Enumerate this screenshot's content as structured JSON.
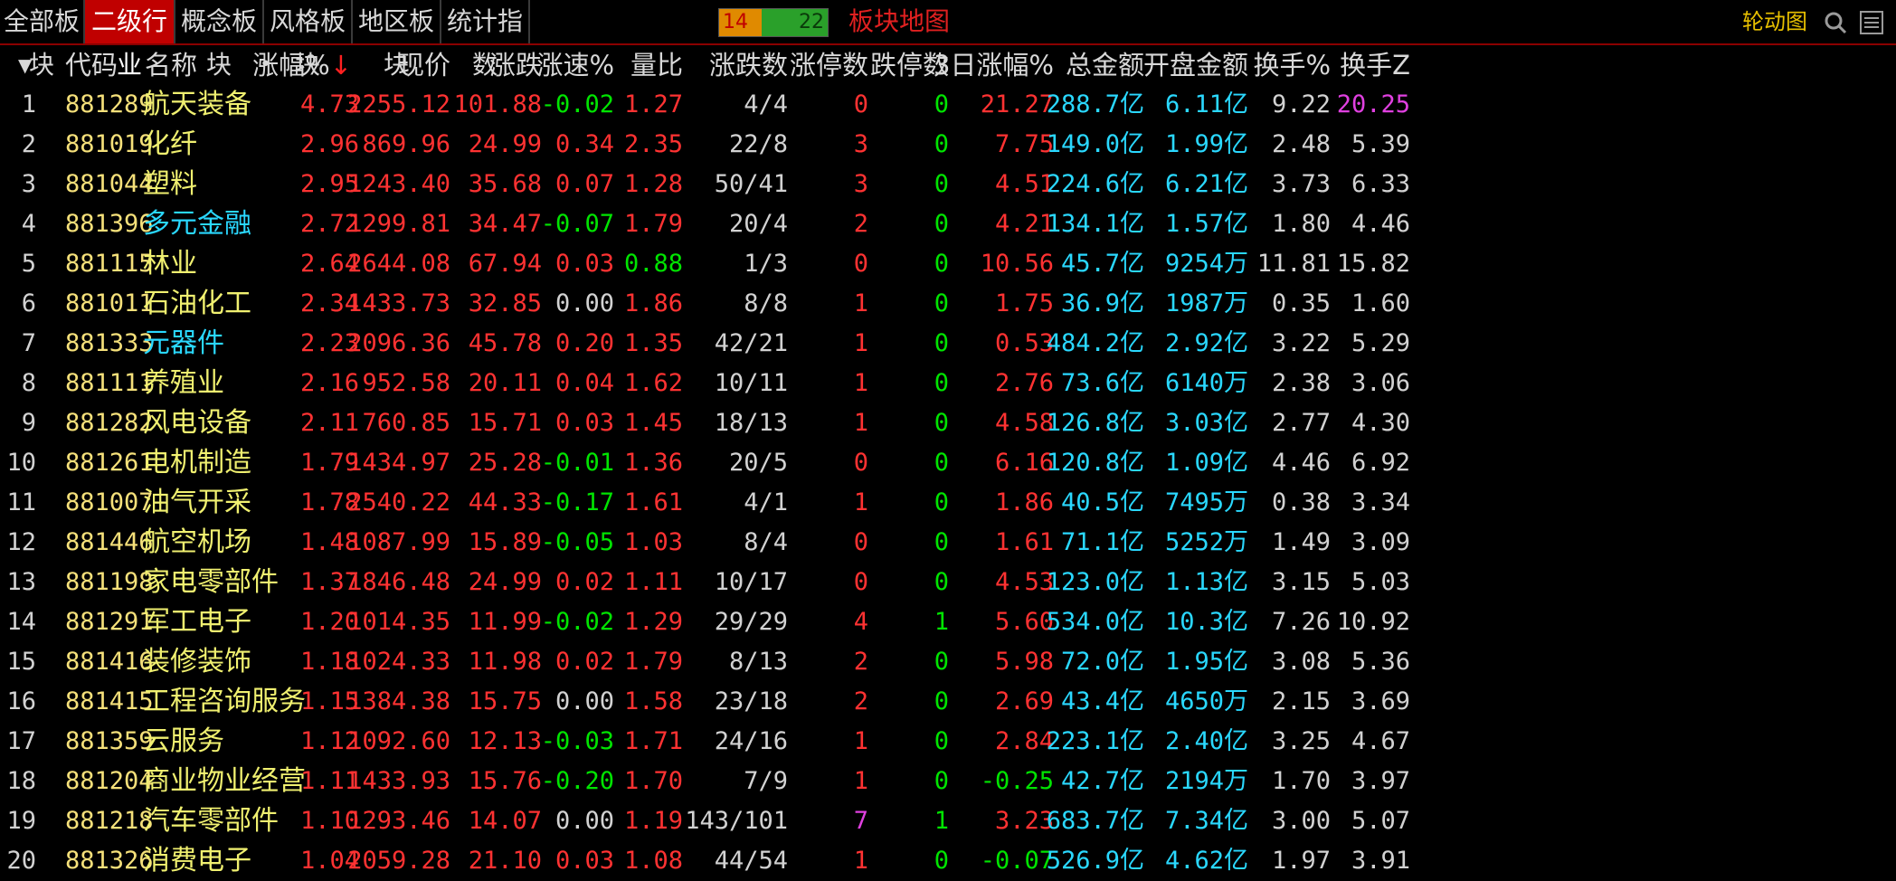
{
  "tabs": [
    "全部板块",
    "二级行业",
    "概念板块",
    "风格板块",
    "地区板块",
    "统计指数"
  ],
  "active_tab": "二级行业",
  "updown_ratio": {
    "up": "14",
    "down": "22"
  },
  "map_label": "板块地图",
  "rotation_label": "轮动图",
  "header": {
    "sort_arrow": "▼",
    "code": "代码",
    "name": "名称",
    "dot": "•",
    "change_pct": "涨幅%",
    "sort_mark": "↓",
    "price": "现价",
    "change": "涨跌",
    "speed": "涨速%",
    "vol_ratio": "量比",
    "up_down": "涨跌数",
    "limit_up": "涨停数",
    "limit_down": "跌停数",
    "chg3d": "3日涨幅%",
    "amount": "总金额",
    "open_amount": "开盘金额",
    "turnover": "换手%",
    "turnover_z": "换手Z"
  },
  "rows": [
    {
      "idx": "1",
      "code": "881289",
      "name": "航天装备",
      "name_color": "yel",
      "pct": "4.73",
      "price": "2255.12",
      "chg": "101.88",
      "speed": "-0.02",
      "vr": "1.27",
      "ud": "4/4",
      "lu": "0",
      "ld": "0",
      "c3": "21.27",
      "amt": "288.7亿",
      "oamt": "6.11亿",
      "to": "9.22",
      "toz": "20.25",
      "toz_color": "mag"
    },
    {
      "idx": "2",
      "code": "881019",
      "name": "化纤",
      "name_color": "yel",
      "pct": "2.96",
      "price": "869.96",
      "chg": "24.99",
      "speed": "0.34",
      "vr": "2.35",
      "ud": "22/8",
      "lu": "3",
      "ld": "0",
      "c3": "7.75",
      "amt": "149.0亿",
      "oamt": "1.99亿",
      "to": "2.48",
      "toz": "5.39",
      "toz_color": "wht"
    },
    {
      "idx": "3",
      "code": "881044",
      "name": "塑料",
      "name_color": "yel",
      "pct": "2.95",
      "price": "1243.40",
      "chg": "35.68",
      "speed": "0.07",
      "vr": "1.28",
      "ud": "50/41",
      "lu": "3",
      "ld": "0",
      "c3": "4.51",
      "amt": "224.6亿",
      "oamt": "6.21亿",
      "to": "3.73",
      "toz": "6.33",
      "toz_color": "wht"
    },
    {
      "idx": "4",
      "code": "881396",
      "name": "多元金融",
      "name_color": "cyan",
      "pct": "2.72",
      "price": "1299.81",
      "chg": "34.47",
      "speed": "-0.07",
      "vr": "1.79",
      "ud": "20/4",
      "lu": "2",
      "ld": "0",
      "c3": "4.21",
      "amt": "134.1亿",
      "oamt": "1.57亿",
      "to": "1.80",
      "toz": "4.46",
      "toz_color": "wht"
    },
    {
      "idx": "5",
      "code": "881115",
      "name": "林业",
      "name_color": "yel",
      "pct": "2.64",
      "price": "2644.08",
      "chg": "67.94",
      "speed": "0.03",
      "vr": "0.88",
      "ud": "1/3",
      "lu": "0",
      "ld": "0",
      "c3": "10.56",
      "amt": "45.7亿",
      "oamt": "9254万",
      "to": "11.81",
      "toz": "15.82",
      "toz_color": "wht"
    },
    {
      "idx": "6",
      "code": "881011",
      "name": "石油化工",
      "name_color": "yel",
      "pct": "2.34",
      "price": "1433.73",
      "chg": "32.85",
      "speed": "0.00",
      "vr": "1.86",
      "ud": "8/8",
      "lu": "1",
      "ld": "0",
      "c3": "1.75",
      "amt": "36.9亿",
      "oamt": "1987万",
      "to": "0.35",
      "toz": "1.60",
      "toz_color": "wht"
    },
    {
      "idx": "7",
      "code": "881333",
      "name": "元器件",
      "name_color": "cyan",
      "pct": "2.23",
      "price": "2096.36",
      "chg": "45.78",
      "speed": "0.20",
      "vr": "1.35",
      "ud": "42/21",
      "lu": "1",
      "ld": "0",
      "c3": "0.53",
      "amt": "484.2亿",
      "oamt": "2.92亿",
      "to": "3.22",
      "toz": "5.29",
      "toz_color": "wht"
    },
    {
      "idx": "8",
      "code": "881111",
      "name": "养殖业",
      "name_color": "yel",
      "pct": "2.16",
      "price": "952.58",
      "chg": "20.11",
      "speed": "0.04",
      "vr": "1.62",
      "ud": "10/11",
      "lu": "1",
      "ld": "0",
      "c3": "2.76",
      "amt": "73.6亿",
      "oamt": "6140万",
      "to": "2.38",
      "toz": "3.06",
      "toz_color": "wht"
    },
    {
      "idx": "9",
      "code": "881282",
      "name": "风电设备",
      "name_color": "yel",
      "pct": "2.11",
      "price": "760.85",
      "chg": "15.71",
      "speed": "0.03",
      "vr": "1.45",
      "ud": "18/13",
      "lu": "1",
      "ld": "0",
      "c3": "4.58",
      "amt": "126.8亿",
      "oamt": "3.03亿",
      "to": "2.77",
      "toz": "4.30",
      "toz_color": "wht"
    },
    {
      "idx": "10",
      "code": "881261",
      "name": "电机制造",
      "name_color": "yel",
      "pct": "1.79",
      "price": "1434.97",
      "chg": "25.28",
      "speed": "-0.01",
      "vr": "1.36",
      "ud": "20/5",
      "lu": "0",
      "ld": "0",
      "c3": "6.16",
      "amt": "120.8亿",
      "oamt": "1.09亿",
      "to": "4.46",
      "toz": "6.92",
      "toz_color": "wht"
    },
    {
      "idx": "11",
      "code": "881007",
      "name": "油气开采",
      "name_color": "yel",
      "pct": "1.78",
      "price": "2540.22",
      "chg": "44.33",
      "speed": "-0.17",
      "vr": "1.61",
      "ud": "4/1",
      "lu": "1",
      "ld": "0",
      "c3": "1.86",
      "amt": "40.5亿",
      "oamt": "7495万",
      "to": "0.38",
      "toz": "3.34",
      "toz_color": "wht"
    },
    {
      "idx": "12",
      "code": "881446",
      "name": "航空机场",
      "name_color": "yel",
      "pct": "1.48",
      "price": "1087.99",
      "chg": "15.89",
      "speed": "-0.05",
      "vr": "1.03",
      "ud": "8/4",
      "lu": "0",
      "ld": "0",
      "c3": "1.61",
      "amt": "71.1亿",
      "oamt": "5252万",
      "to": "1.49",
      "toz": "3.09",
      "toz_color": "wht"
    },
    {
      "idx": "13",
      "code": "881198",
      "name": "家电零部件",
      "name_color": "yel",
      "pct": "1.37",
      "price": "1846.48",
      "chg": "24.99",
      "speed": "0.02",
      "vr": "1.11",
      "ud": "10/17",
      "lu": "0",
      "ld": "0",
      "c3": "4.53",
      "amt": "123.0亿",
      "oamt": "1.13亿",
      "to": "3.15",
      "toz": "5.03",
      "toz_color": "wht"
    },
    {
      "idx": "14",
      "code": "881291",
      "name": "军工电子",
      "name_color": "yel",
      "pct": "1.20",
      "price": "1014.35",
      "chg": "11.99",
      "speed": "-0.02",
      "vr": "1.29",
      "ud": "29/29",
      "lu": "4",
      "ld": "1",
      "c3": "5.60",
      "amt": "534.0亿",
      "oamt": "10.3亿",
      "to": "7.26",
      "toz": "10.92",
      "toz_color": "wht"
    },
    {
      "idx": "15",
      "code": "881416",
      "name": "装修装饰",
      "name_color": "yel",
      "pct": "1.18",
      "price": "1024.33",
      "chg": "11.98",
      "speed": "0.02",
      "vr": "1.79",
      "ud": "8/13",
      "lu": "2",
      "ld": "0",
      "c3": "5.98",
      "amt": "72.0亿",
      "oamt": "1.95亿",
      "to": "3.08",
      "toz": "5.36",
      "toz_color": "wht"
    },
    {
      "idx": "16",
      "code": "881415",
      "name": "工程咨询服务",
      "name_color": "yel",
      "pct": "1.15",
      "price": "1384.38",
      "chg": "15.75",
      "speed": "0.00",
      "vr": "1.58",
      "ud": "23/18",
      "lu": "2",
      "ld": "0",
      "c3": "2.69",
      "amt": "43.4亿",
      "oamt": "4650万",
      "to": "2.15",
      "toz": "3.69",
      "toz_color": "wht"
    },
    {
      "idx": "17",
      "code": "881359",
      "name": "云服务",
      "name_color": "yel",
      "pct": "1.12",
      "price": "1092.60",
      "chg": "12.13",
      "speed": "-0.03",
      "vr": "1.71",
      "ud": "24/16",
      "lu": "1",
      "ld": "0",
      "c3": "2.84",
      "amt": "223.1亿",
      "oamt": "2.40亿",
      "to": "3.25",
      "toz": "4.67",
      "toz_color": "wht"
    },
    {
      "idx": "18",
      "code": "881204",
      "name": "商业物业经营",
      "name_color": "yel",
      "pct": "1.11",
      "price": "1433.93",
      "chg": "15.76",
      "speed": "-0.20",
      "vr": "1.70",
      "ud": "7/9",
      "lu": "1",
      "ld": "0",
      "c3": "-0.25",
      "amt": "42.7亿",
      "oamt": "2194万",
      "to": "1.70",
      "toz": "3.97",
      "toz_color": "wht"
    },
    {
      "idx": "19",
      "code": "881218",
      "name": "汽车零部件",
      "name_color": "yel",
      "pct": "1.10",
      "price": "1293.46",
      "chg": "14.07",
      "speed": "0.00",
      "vr": "1.19",
      "ud": "143/101",
      "lu": "7",
      "ld": "1",
      "c3": "3.23",
      "amt": "683.7亿",
      "oamt": "7.34亿",
      "to": "3.00",
      "toz": "5.07",
      "toz_color": "wht"
    },
    {
      "idx": "20",
      "code": "881326",
      "name": "消费电子",
      "name_color": "yel",
      "pct": "1.04",
      "price": "2059.28",
      "chg": "21.10",
      "speed": "0.03",
      "vr": "1.08",
      "ud": "44/54",
      "lu": "1",
      "ld": "0",
      "c3": "-0.07",
      "amt": "526.9亿",
      "oamt": "4.62亿",
      "to": "1.97",
      "toz": "3.91",
      "toz_color": "wht"
    }
  ],
  "colors": {
    "up": "#ff3232",
    "down": "#00e400",
    "accent": "#c00000",
    "cyan": "#2ad8ff",
    "yellow": "#f0f070"
  }
}
